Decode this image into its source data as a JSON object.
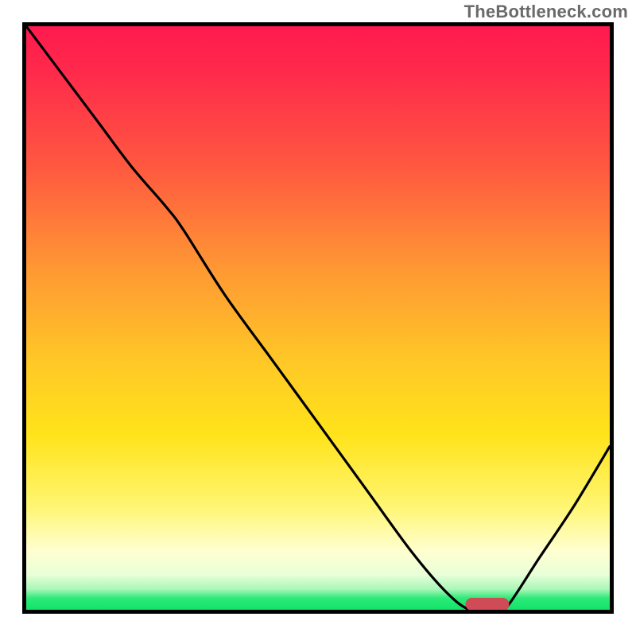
{
  "watermark": "TheBottleneck.com",
  "colors": {
    "frame_border": "#000000",
    "curve": "#000000",
    "marker": "#cf4b55",
    "gradient_top": "#ff1a4e",
    "gradient_mid": "#ffe31a",
    "gradient_bottom": "#12e36b"
  },
  "chart_data": {
    "type": "line",
    "title": "",
    "xlabel": "",
    "ylabel": "",
    "xlim": [
      0,
      100
    ],
    "ylim": [
      0,
      100
    ],
    "grid": false,
    "legend": false,
    "notes": "Single black curve over vertical red→yellow→green gradient. Curve descends from top-left, reaches zero near x≈76–82 (flat valley), then rises toward x=100. Y-axis orientation: 0 at bottom, 100 at top. A rounded red marker sits at the valley floor (~x 79, y 0). Values estimated from pixel positions; chart has no tick labels.",
    "series": [
      {
        "name": "curve",
        "x": [
          0,
          6,
          12,
          18,
          24,
          27,
          34,
          42,
          50,
          58,
          66,
          72,
          76,
          80,
          82,
          88,
          94,
          100
        ],
        "y": [
          100,
          92,
          84,
          76,
          69,
          65,
          54,
          43,
          32,
          21,
          10,
          3,
          0,
          0,
          0,
          9,
          18,
          28
        ]
      }
    ],
    "marker": {
      "x": 79,
      "y": 0,
      "shape": "rounded-bar"
    }
  }
}
